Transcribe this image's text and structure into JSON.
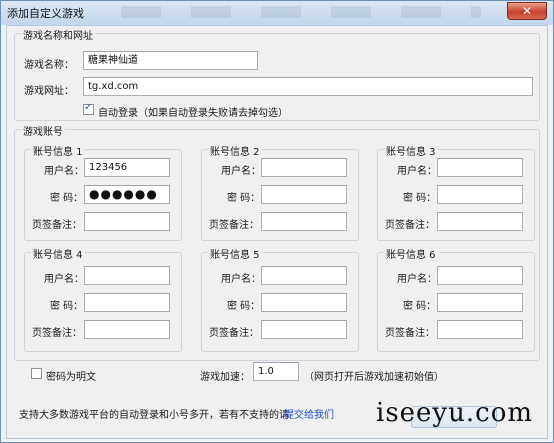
{
  "window": {
    "title": "添加自定义游戏",
    "close_label": "✕"
  },
  "game_info": {
    "legend": "游戏名称和网址",
    "name_label": "游戏名称：",
    "name_value": "糖果神仙道",
    "url_label": "游戏网址：",
    "url_value": "tg.xd.com",
    "auto_login_checked": true,
    "auto_login_label": "自动登录（如果自动登录失败请去掉勾选）"
  },
  "accounts": {
    "legend": "游戏账号",
    "user_label": "用户名：",
    "pwd_label": "密  码：",
    "note_label": "页签备注：",
    "items": [
      {
        "title": "账号信息 1",
        "user": "123456",
        "password": "●●●●●●",
        "note": ""
      },
      {
        "title": "账号信息 2",
        "user": "",
        "password": "",
        "note": ""
      },
      {
        "title": "账号信息 3",
        "user": "",
        "password": "",
        "note": ""
      },
      {
        "title": "账号信息 4",
        "user": "",
        "password": "",
        "note": ""
      },
      {
        "title": "账号信息 5",
        "user": "",
        "password": "",
        "note": ""
      },
      {
        "title": "账号信息 6",
        "user": "",
        "password": "",
        "note": ""
      }
    ]
  },
  "options": {
    "plaintext_checked": false,
    "plaintext_label": "密码为明文",
    "speed_label": "游戏加速：",
    "speed_value": "1.0",
    "speed_hint": "（网页打开后游戏加速初始值）"
  },
  "footer": {
    "support_text": "支持大多数游戏平台的自动登录和小号多开，若有不支持的请",
    "submit_link": "提交给我们",
    "watermark": "iseeyu.com"
  },
  "colors": {
    "link": "#1f4fc9",
    "close": "#c7412a"
  }
}
